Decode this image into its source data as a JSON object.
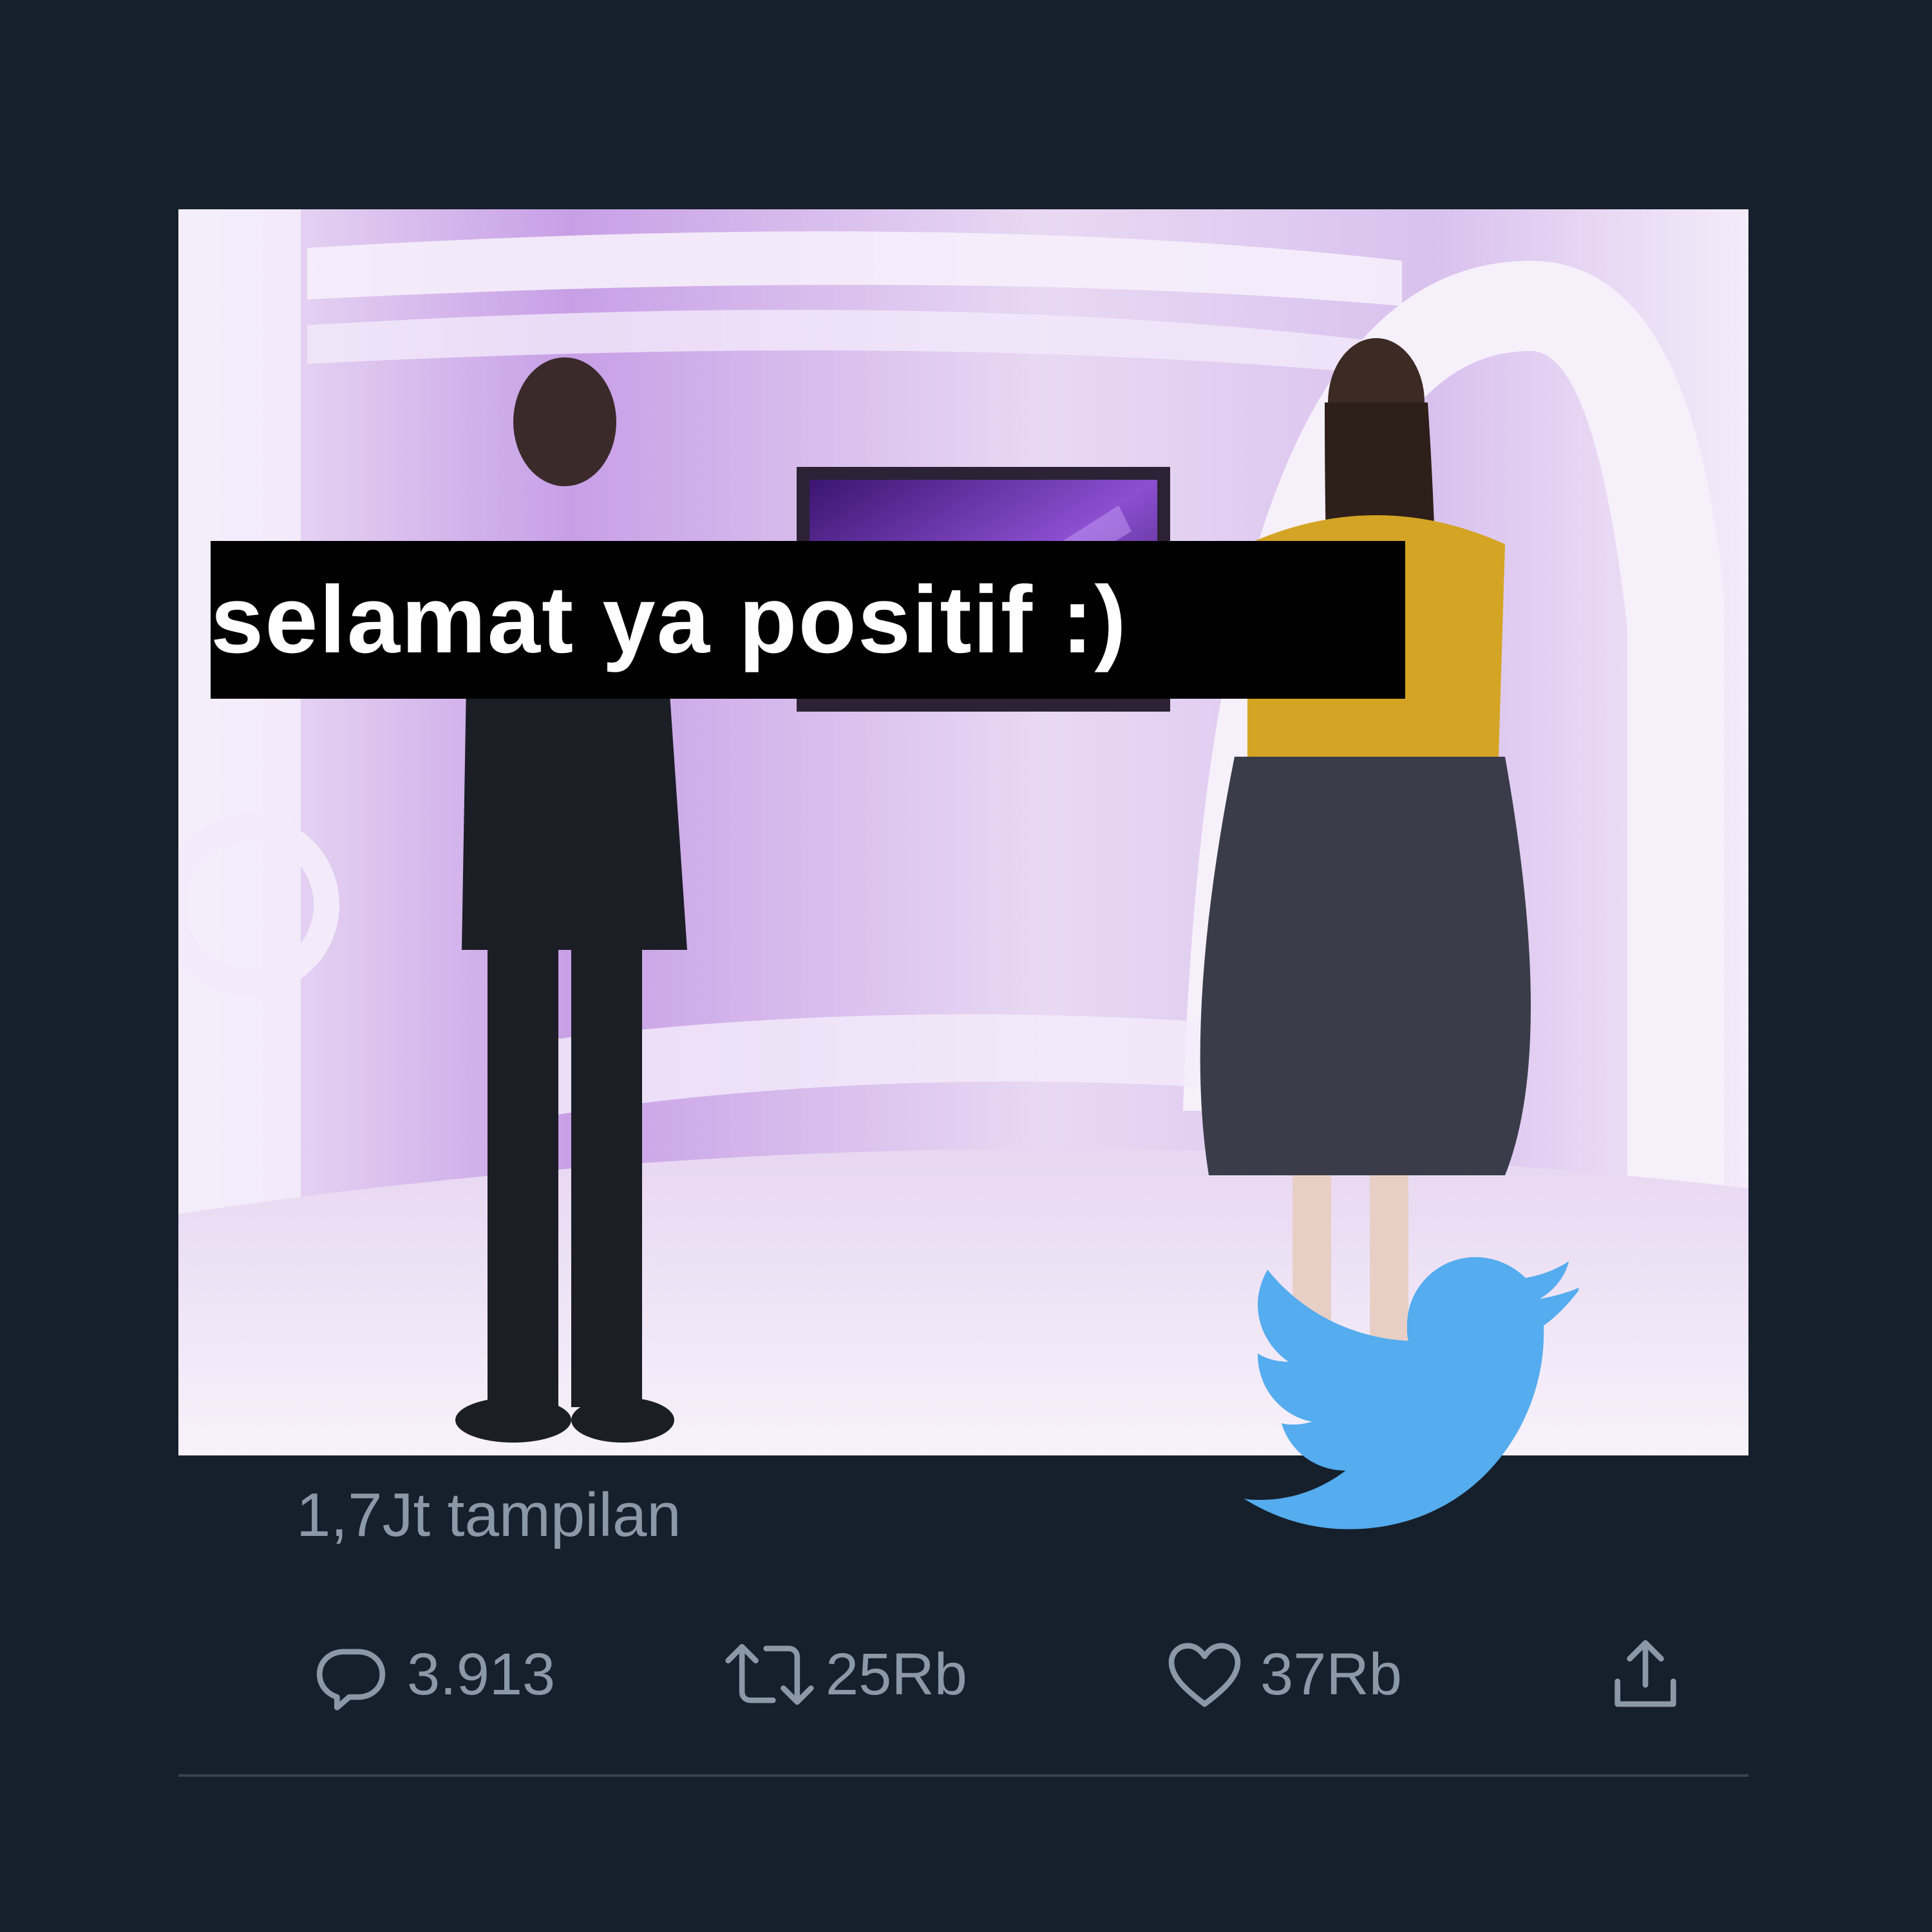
{
  "theme": {
    "background": "#16202c",
    "muted_text": "#8b98a5",
    "divider": "#38444d",
    "brand_blue": "#55acee"
  },
  "media": {
    "caption": "selamat ya positif :)"
  },
  "tweet_stats": {
    "views": "1,7Jt tampilan",
    "replies": "3.913",
    "retweets": "25Rb",
    "likes": "37Rb"
  },
  "icons": {
    "reply": "reply-icon",
    "retweet": "retweet-icon",
    "like": "heart-icon",
    "share": "share-icon",
    "logo": "twitter-bird-icon"
  }
}
